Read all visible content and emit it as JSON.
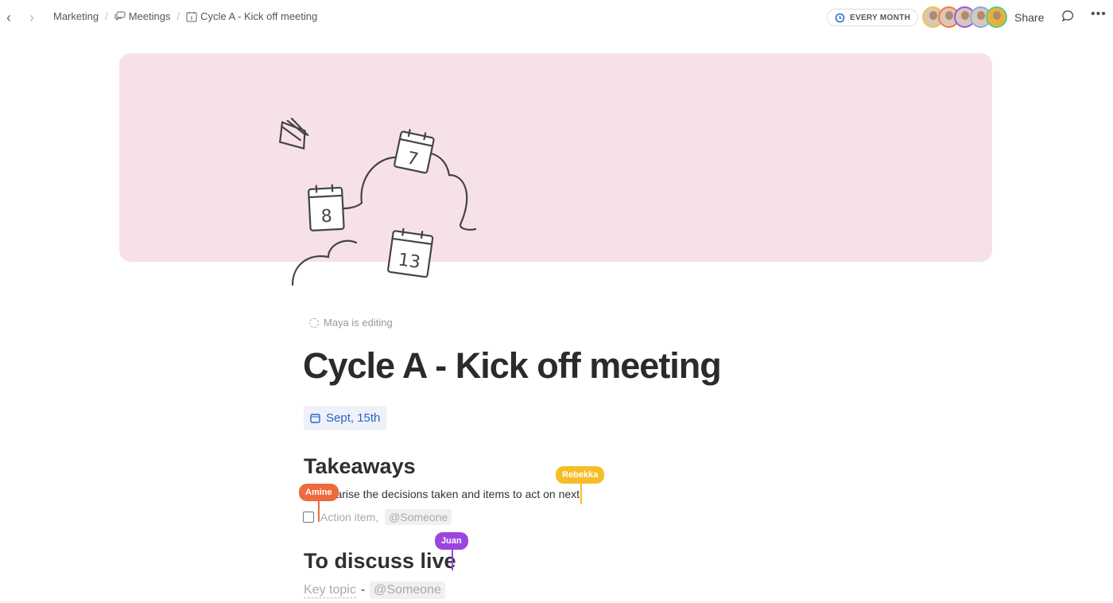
{
  "nav": {
    "back_icon": "chevron-left-icon",
    "forward_icon": "chevron-right-icon"
  },
  "breadcrumb": [
    {
      "label": "Marketing"
    },
    {
      "label": "Meetings",
      "icon": "chat-bubbles-icon"
    },
    {
      "label": "Cycle A - Kick off meeting",
      "icon": "calendar-icon"
    }
  ],
  "header": {
    "recurrence": "EVERY MONTH",
    "share": "Share",
    "avatar_colors": [
      "#f5c443",
      "#f07a4a",
      "#9b59e0",
      "#7fb3ea",
      "#5cc98a"
    ]
  },
  "status": {
    "editing": "Maya is editing"
  },
  "page": {
    "title": "Cycle A - Kick off meeting",
    "date": "Sept, 15th",
    "takeaways": {
      "heading": "Takeaways",
      "text": "Summarise the decisions taken and items to act on next",
      "action": "Action item,",
      "mention": "@Someone"
    },
    "discuss": {
      "heading": "To discuss live",
      "key_topic": "Key topic",
      "dash": "-",
      "mention": "@Someone"
    }
  },
  "cursors": [
    {
      "name": "Amine",
      "color": "#ef6a3c"
    },
    {
      "name": "Rebekka",
      "color": "#f6bd27"
    },
    {
      "name": "Juan",
      "color": "#9b45e0"
    }
  ],
  "illustration": {
    "calendar_numbers": [
      "7",
      "8",
      "13"
    ]
  }
}
